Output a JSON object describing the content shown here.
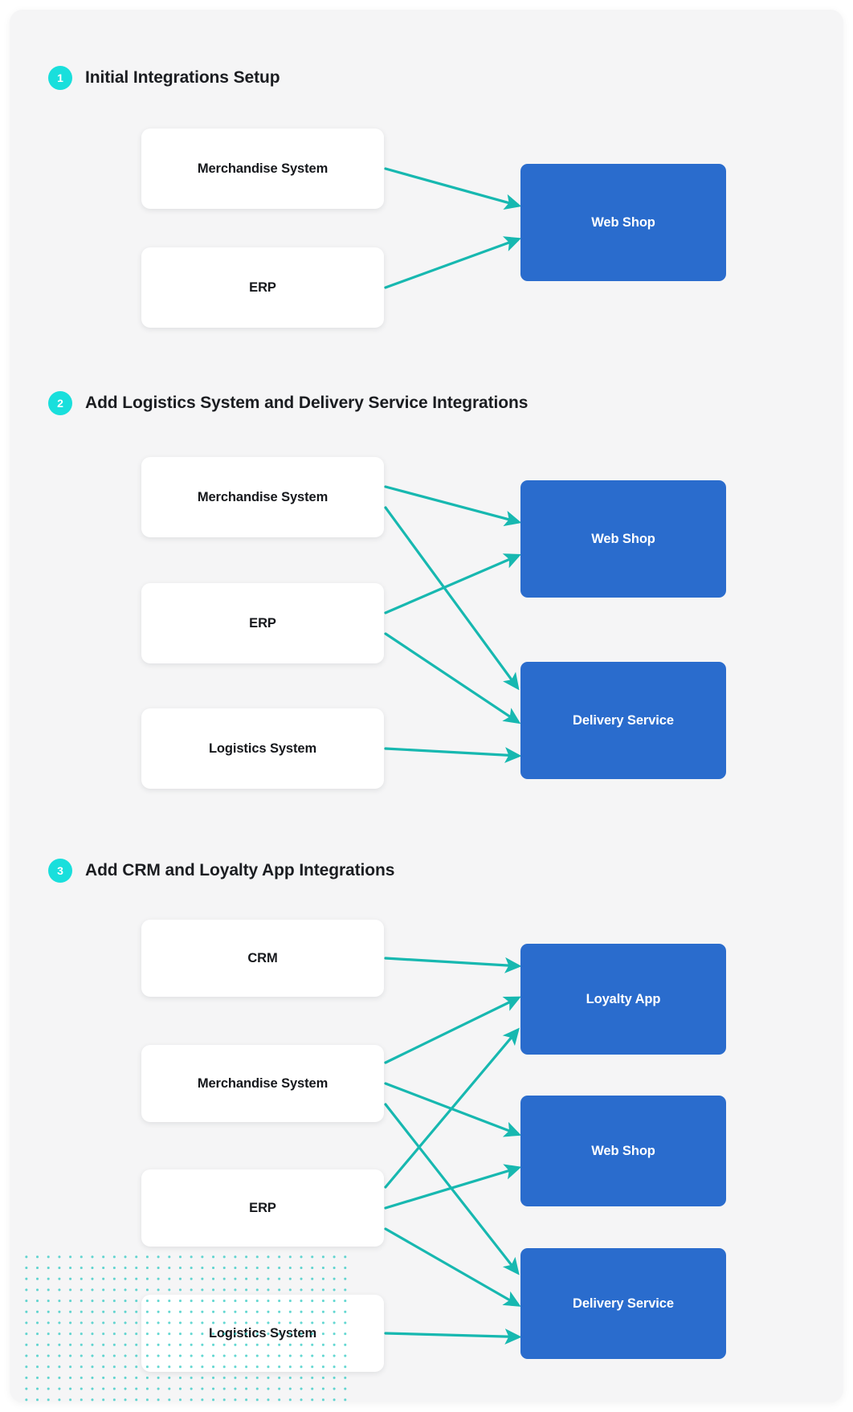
{
  "colors": {
    "canvas_bg": "#f5f5f6",
    "page_bg": "#ffffff",
    "badge": "#19DFDC",
    "arrow": "#17b8b0",
    "target_box": "#2a6ccd",
    "source_box": "#ffffff",
    "title_text": "#1b1d21",
    "dot_grid": "#2ec9c2"
  },
  "sections": [
    {
      "number": "1",
      "title": "Initial Integrations Setup",
      "sources": [
        {
          "label": "Merchandise System"
        },
        {
          "label": "ERP"
        }
      ],
      "targets": [
        {
          "label": "Web Shop"
        }
      ],
      "links": [
        {
          "from": "Merchandise System",
          "to": "Web Shop"
        },
        {
          "from": "ERP",
          "to": "Web Shop"
        }
      ]
    },
    {
      "number": "2",
      "title": "Add Logistics System and Delivery Service Integrations",
      "sources": [
        {
          "label": "Merchandise System"
        },
        {
          "label": "ERP"
        },
        {
          "label": "Logistics System"
        }
      ],
      "targets": [
        {
          "label": "Web Shop"
        },
        {
          "label": "Delivery Service"
        }
      ],
      "links": [
        {
          "from": "Merchandise System",
          "to": "Web Shop"
        },
        {
          "from": "Merchandise System",
          "to": "Delivery Service"
        },
        {
          "from": "ERP",
          "to": "Web Shop"
        },
        {
          "from": "ERP",
          "to": "Delivery Service"
        },
        {
          "from": "Logistics System",
          "to": "Delivery Service"
        }
      ]
    },
    {
      "number": "3",
      "title": "Add CRM and Loyalty App Integrations",
      "sources": [
        {
          "label": "CRM"
        },
        {
          "label": "Merchandise System"
        },
        {
          "label": "ERP"
        },
        {
          "label": "Logistics System"
        }
      ],
      "targets": [
        {
          "label": "Loyalty App"
        },
        {
          "label": "Web Shop"
        },
        {
          "label": "Delivery Service"
        }
      ],
      "links": [
        {
          "from": "CRM",
          "to": "Loyalty App"
        },
        {
          "from": "Merchandise System",
          "to": "Loyalty App"
        },
        {
          "from": "Merchandise System",
          "to": "Web Shop"
        },
        {
          "from": "Merchandise System",
          "to": "Delivery Service"
        },
        {
          "from": "ERP",
          "to": "Loyalty App"
        },
        {
          "from": "ERP",
          "to": "Web Shop"
        },
        {
          "from": "ERP",
          "to": "Delivery Service"
        },
        {
          "from": "Logistics System",
          "to": "Delivery Service"
        }
      ]
    }
  ]
}
